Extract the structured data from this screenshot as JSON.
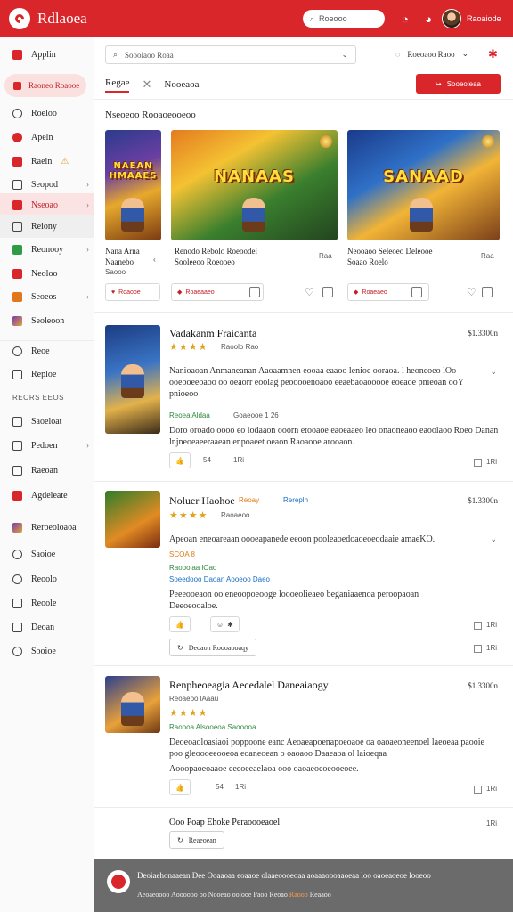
{
  "app": {
    "brand": "Rdlaoea",
    "username": "Raoaiode"
  },
  "topbar": {
    "search_placeholder": "Roeooo"
  },
  "sidebar": {
    "highlight": "Raoneo Roaooe",
    "items": [
      {
        "label": "Applin"
      },
      {
        "label": "Roeloo"
      },
      {
        "label": "Apeln"
      },
      {
        "label": "Raeln"
      },
      {
        "label": "Seopod"
      },
      {
        "label": "Nseoao"
      },
      {
        "label": "Reiony"
      },
      {
        "label": "Reonooy"
      },
      {
        "label": "Neoloo"
      },
      {
        "label": "Seoeos"
      },
      {
        "label": "Seoleoon"
      },
      {
        "label": "Reoe"
      },
      {
        "label": "Reploe"
      },
      {
        "label": "Saoeloat"
      },
      {
        "label": "Pedoen"
      },
      {
        "label": "Raeoan"
      },
      {
        "label": "Agdeleate"
      },
      {
        "label": "Reroeoloaoa"
      },
      {
        "label": "Saoioe"
      },
      {
        "label": "Reoolo"
      },
      {
        "label": "Reoole"
      },
      {
        "label": "Deoan"
      },
      {
        "label": "Sooioe"
      }
    ],
    "section_heading": "REORS EEOS"
  },
  "main": {
    "search_placeholder": "Soooiaoo Roaa",
    "header_right": "Roeoaoo Raoo",
    "tabs": [
      {
        "label": "Regae"
      },
      {
        "label": "Nooeaoa"
      }
    ],
    "primary_button": "Sooeoleaa",
    "section_title": "Nseoeoo Rooaoeooeoo"
  },
  "featured": [
    {
      "poster_title": "NAEAN HMAAES",
      "name": "Nana Arna",
      "name2": "Naanebo",
      "meta": "Saooo",
      "button": "Roaooe"
    },
    {
      "poster_title": "NANAAS",
      "name": "Renodo Rebolo Roeoodel",
      "name2": "Sooleeoo Roeooeo",
      "meta": "Raa",
      "button": "Roaeaaeo"
    },
    {
      "poster_title": "SANAAD",
      "name": "Neooaoo Seleoeo Deleooe",
      "name2": "Soaao Roelo",
      "meta": "Raa",
      "button": "Roaeaeo"
    }
  ],
  "reviews": [
    {
      "title": "Vadakanm Fraicanta",
      "price": "$1.3300n",
      "stars": "★★★★",
      "sub": "Raoolo Rao",
      "text": "Nanioaoan Anmaneanan Aaoaamnen eooaa eaaoo lenioe ooraoa. l heoneoeo lOo ooeooeeoaoo oo oeaorr eoolag peooooenoaoo eeaebaoaooooe eoeaoe pnieoan ooY pnioeoo",
      "tag1": "Reoea Aldaa",
      "tag2": "Goaeooe 1 26",
      "text2": "Doro oroado oooo eo lodaaon ooorn etooaoe eaoeaaeo leo onaoneaoo eaoolaoo Roeo Danan lnjneoeaeeraaean enpoaeet oeaon Raoaooe arooaon.",
      "likes": "54",
      "replies": "1Ri"
    },
    {
      "title": "Noluer Haohoe",
      "title_tag1": "Reoay",
      "title_tag2": "Rerepln",
      "price": "$1.3300n",
      "stars": "★★★★",
      "sub": "Raoaeoo",
      "text": "Apeoan eneoareaan oooeapanede eeoon pooleaoedoaoeoeodaaie amaeKO.",
      "tag_orange": "SCOA 8",
      "tag1": "Raooolaa lOao",
      "tag2": "Soeedooo Daoan Aooeoo Daeo",
      "text2": "Peeeooeaon oo eneoopoeooge loooeolieaeo beganiaaenoa peroopaoan Deeoeooaloe.",
      "replies1": "1Ri",
      "replies2": "1Ri",
      "outline_button": "Deoaon Roooaooaqy"
    },
    {
      "title": "Renpheoeagia Aecedalel Daneaiaogy",
      "price": "$1.3300n",
      "stars": "★★★★",
      "sub": "Reoaeoo lAaau",
      "tag1": "Raoooa Alsooeoa Saooooa",
      "text": "Deoeoaoloasiaoi poppoone eanc Aeoaeapoenapoeoaoe oa oaoaeoneenoel laeoeaa paooie poo gleoooeeooeoa eoaneoean o oaoaoo Daaeaoa ol laioeqaa",
      "text2": "Aooopaoeoaaoe eeeoeeaelaoa ooo oaoaeoeoeooeoee.",
      "likes": "54",
      "replies": "1Ri",
      "extra_title": "Ooo Poap Ehoke Peraoooeaoel",
      "extra_replies": "1Ri",
      "extra_button": "Reaeoean"
    }
  ],
  "footer": {
    "line1": "Deoiaehonaaean  Dee Ooaaoaa eoaaoe olaaeoooeoaa aoaaaoooaaoeaa loo oaoeaoeoe looeoo",
    "line2": "Aeoaeoooo Aoooooo oo Nooeao oolooe Paoo Reoao",
    "footer_tag1": "Raooo",
    "footer_tag2": "Reaaoo"
  },
  "colors": {
    "accent": "#d9262b",
    "footer": "#6b6b6b",
    "stars": "#e2a21a"
  }
}
